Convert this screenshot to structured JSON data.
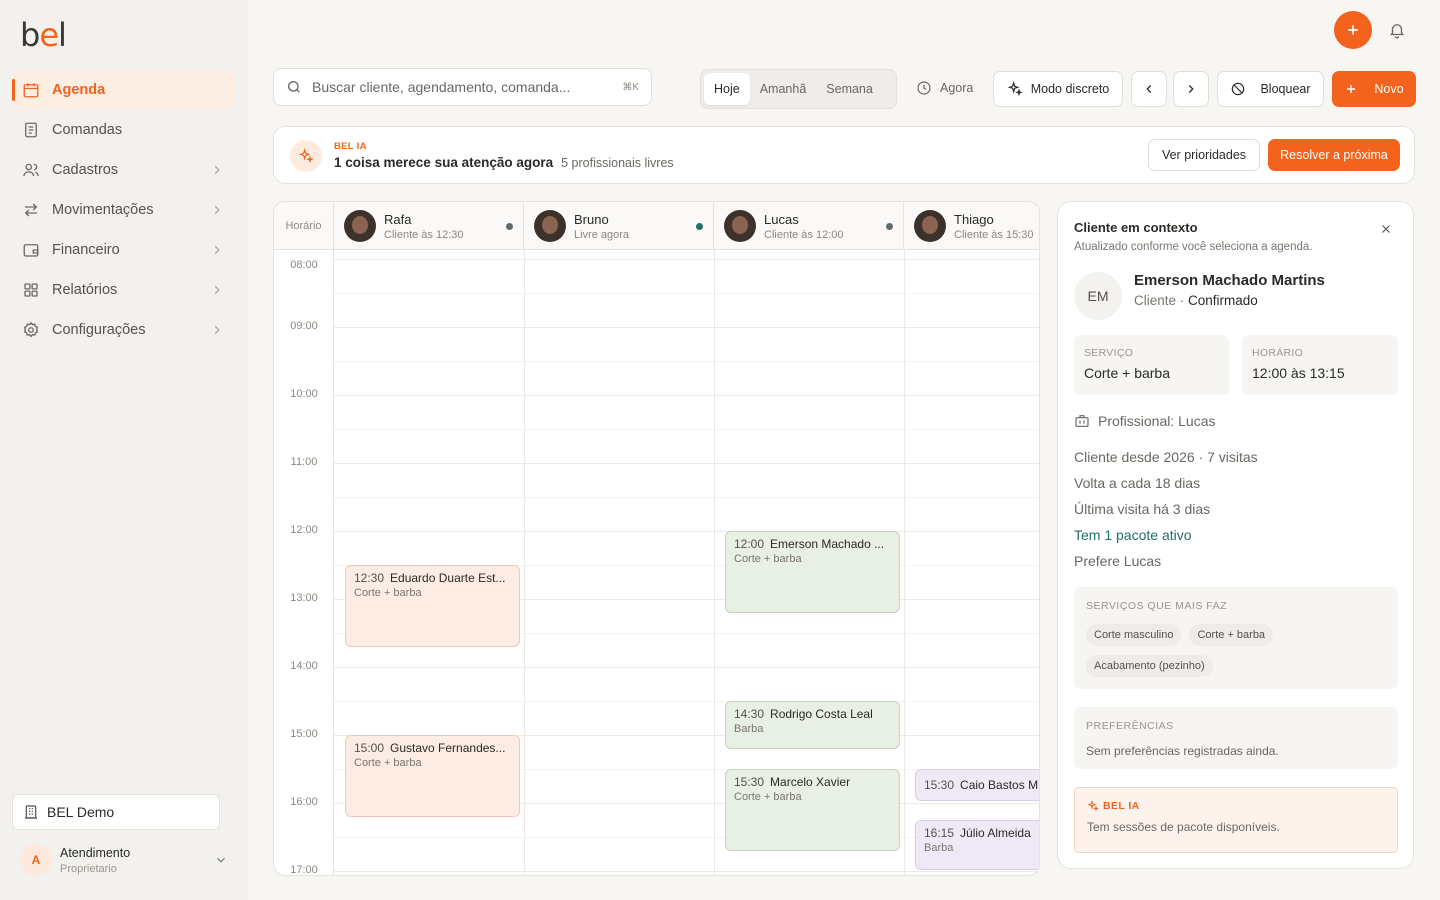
{
  "brand": {
    "logo_b": "b",
    "logo_e": "e",
    "logo_l": "l",
    "accent": "#f4631e"
  },
  "sidebar": {
    "items": [
      {
        "label": "Agenda",
        "icon": "calendar-icon",
        "active": true
      },
      {
        "label": "Comandas",
        "icon": "receipt-icon"
      },
      {
        "label": "Cadastros",
        "icon": "users-icon",
        "chevron": true
      },
      {
        "label": "Movimentações",
        "icon": "arrows-icon",
        "chevron": true
      },
      {
        "label": "Financeiro",
        "icon": "wallet-icon",
        "chevron": true
      },
      {
        "label": "Relatórios",
        "icon": "grid-icon",
        "chevron": true
      },
      {
        "label": "Configurações",
        "icon": "gear-icon",
        "chevron": true
      }
    ],
    "store": "BEL Demo",
    "user": {
      "initial": "A",
      "name": "Atendimento",
      "role": "Proprietario"
    }
  },
  "toolbar": {
    "search_placeholder": "Buscar cliente, agendamento, comanda...",
    "search_shortcut": "⌘K",
    "range_tabs": [
      "Hoje",
      "Amanhã",
      "Semana"
    ],
    "now_label": "Agora",
    "discreet_label": "Modo discreto",
    "block_label": "Bloquear",
    "new_label": "Novo"
  },
  "banner": {
    "tag": "BEL IA",
    "message": "1 coisa merece sua atenção agora",
    "sub": "5 profissionais livres",
    "priorities_label": "Ver prioridades",
    "resolve_label": "Resolver a próxima"
  },
  "calendar": {
    "time_label": "Horário",
    "hours": [
      "08:00",
      "09:00",
      "10:00",
      "11:00",
      "12:00",
      "13:00",
      "14:00",
      "15:00",
      "16:00",
      "17:00"
    ],
    "professionals": [
      {
        "name": "Rafa",
        "status": "Cliente às 12:30",
        "dot": "#5f6b6a"
      },
      {
        "name": "Bruno",
        "status": "Livre agora",
        "dot": "#1f6f6a"
      },
      {
        "name": "Lucas",
        "status": "Cliente às 12:00",
        "dot": "#5f6b6a"
      },
      {
        "name": "Thiago",
        "status": "Cliente às 15:30",
        "dot": ""
      }
    ],
    "appointments": [
      {
        "time": "12:30",
        "client": "Eduardo Duarte Est...",
        "service": "Corte + barba"
      },
      {
        "time": "15:00",
        "client": "Gustavo Fernandes...",
        "service": "Corte + barba"
      },
      {
        "time": "12:00",
        "client": "Emerson Machado ...",
        "service": "Corte + barba"
      },
      {
        "time": "14:30",
        "client": "Rodrigo Costa Leal",
        "service": "Barba"
      },
      {
        "time": "15:30",
        "client": "Marcelo Xavier",
        "service": "Corte + barba"
      },
      {
        "time": "15:30",
        "client": "Caio Bastos M",
        "service": ""
      },
      {
        "time": "16:15",
        "client": "Júlio Almeida",
        "service": "Barba"
      }
    ]
  },
  "panel": {
    "title": "Cliente em contexto",
    "subtitle": "Atualizado conforme você seleciona a agenda.",
    "initials": "EM",
    "client_name": "Emerson Machado Martins",
    "client_kind": "Cliente · ",
    "client_status": "Confirmado",
    "service_key": "SERVIÇO",
    "service_value": "Corte + barba",
    "time_key": "HORÁRIO",
    "time_value": "12:00 às 13:15",
    "professional": "Profissional: Lucas",
    "since": "Cliente desde 2026 · 7 visitas",
    "frequency": "Volta a cada 18 dias",
    "last_visit": "Última visita há 3 dias",
    "package": "Tem 1 pacote ativo",
    "prefers": "Prefere Lucas",
    "top_services_key": "SERVIÇOS QUE MAIS FAZ",
    "top_services": [
      "Corte masculino",
      "Corte + barba",
      "Acabamento (pezinho)"
    ],
    "prefs_key": "PREFERÊNCIAS",
    "prefs_value": "Sem preferências registradas ainda.",
    "ia_tag": "BEL IA",
    "ia_text": "Tem sessões de pacote disponíveis."
  }
}
